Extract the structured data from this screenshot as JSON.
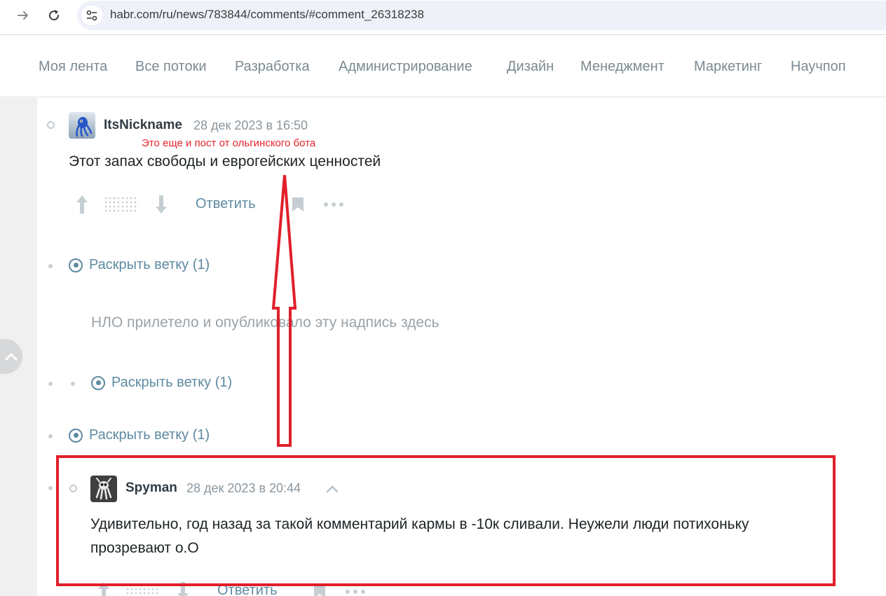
{
  "browser": {
    "url": "habr.com/ru/news/783844/comments/#comment_26318238"
  },
  "nav": {
    "items": [
      "Моя лента",
      "Все потоки",
      "Разработка",
      "Администрирование",
      "Дизайн",
      "Менеджмент",
      "Маркетинг",
      "Научпоп"
    ]
  },
  "comment1": {
    "username": "ItsNickname",
    "date": "28 дек 2023 в 16:50",
    "text": "Этот запах свободы и еврогейских ценностей",
    "annotation": "Это еще и пост от ольгинского бота",
    "reply_label": "Ответить"
  },
  "expand": {
    "first": "Раскрыть ветку (1)",
    "second": "Раскрыть ветку (1)",
    "third": "Раскрыть ветку (1)"
  },
  "ufo": {
    "text": "НЛО прилетело и опубликовало эту надпись здесь"
  },
  "comment2": {
    "username": "Spyman",
    "date": "28 дек 2023 в 20:44",
    "text": "Удивительно, год назад за такой комментарий кармы в -10к сливали. Неужели люди потихоньку прозревают о.О",
    "reply_label": "Ответить"
  },
  "colors": {
    "annotation_red": "#e0202a",
    "link_blue": "#5e8aa0",
    "nav_gray": "#7b8a93"
  },
  "icons": {
    "forward": "forward-arrow-icon",
    "reload": "reload-icon",
    "site_settings": "site-settings-icon",
    "vote_up": "arrow-up-icon",
    "vote_down": "arrow-down-icon",
    "bookmark": "bookmark-icon",
    "more": "more-dots-icon",
    "expand": "expand-circle-icon",
    "scroll_top": "chevron-up-icon",
    "collapse": "chevron-up-icon"
  }
}
